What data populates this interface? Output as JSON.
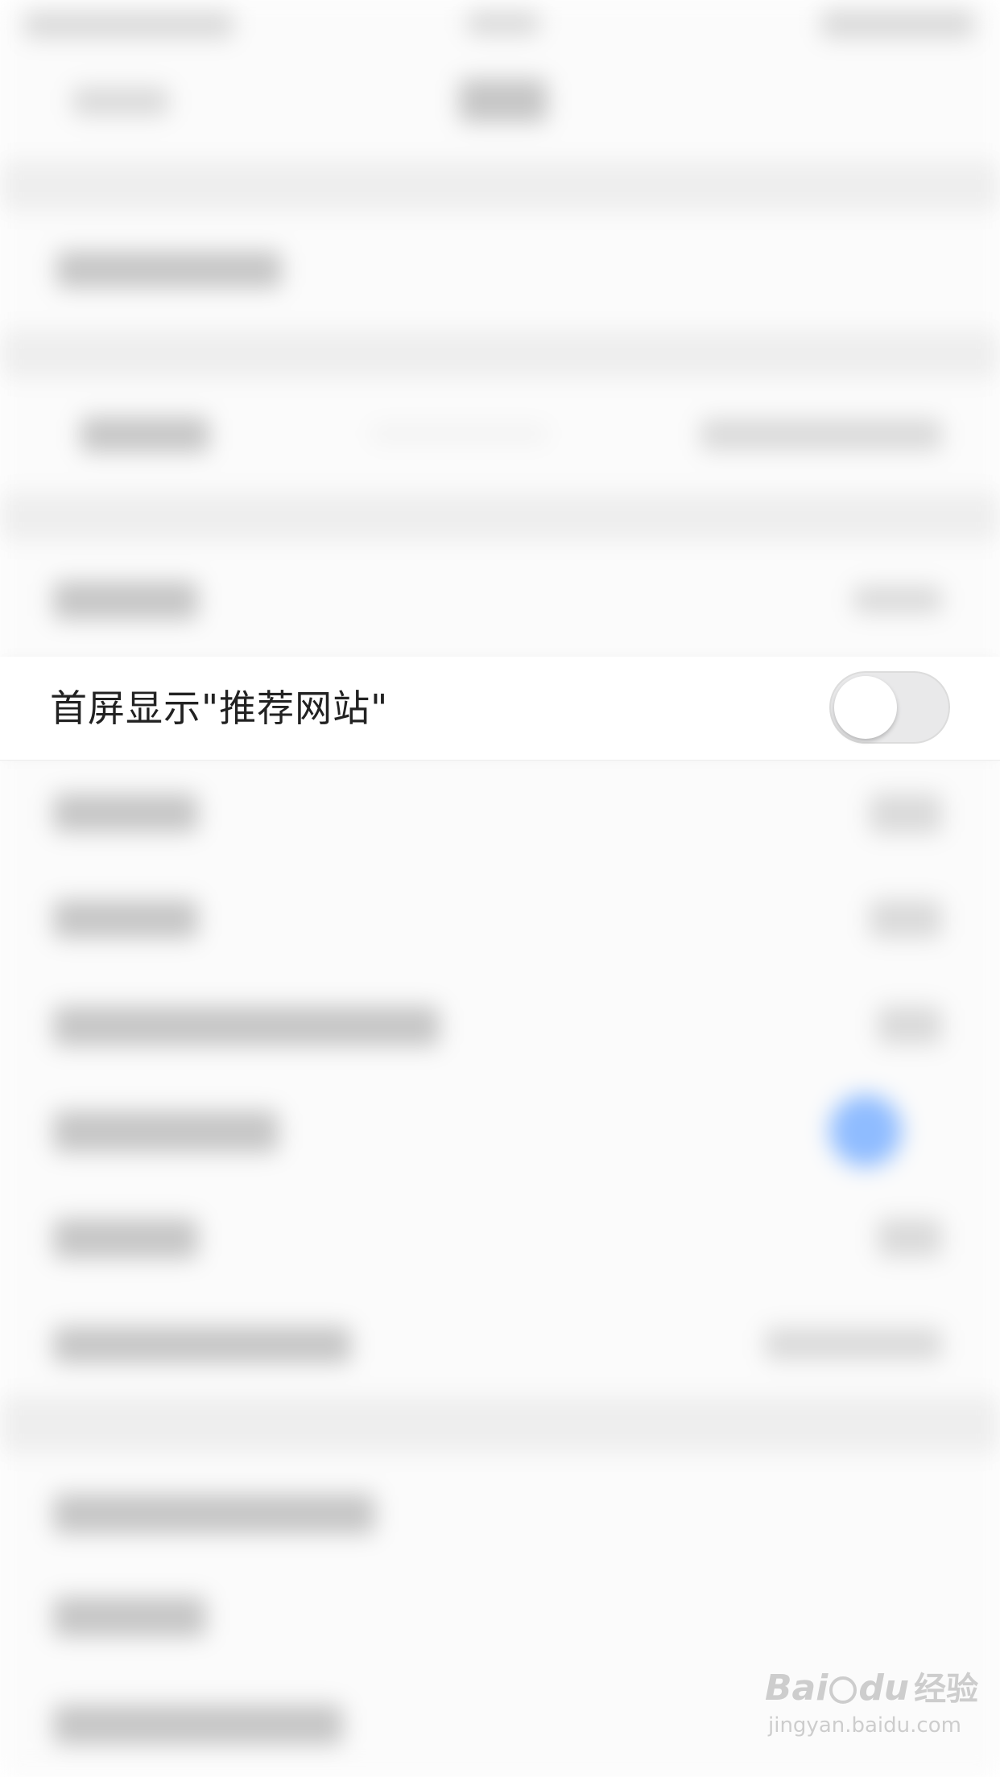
{
  "focus_setting": {
    "label": "首屏显示\"推荐网站\"",
    "toggle_state": "off"
  },
  "watermark": {
    "brand": "Bai",
    "brand_suffix": "du",
    "brand_cn": "经验",
    "url": "jingyan.baidu.com"
  },
  "colors": {
    "toggle_off_track": "#e9e9ea",
    "toggle_knob": "#ffffff",
    "blurred_toggle_on": "#8fbcff",
    "text": "#222222"
  }
}
